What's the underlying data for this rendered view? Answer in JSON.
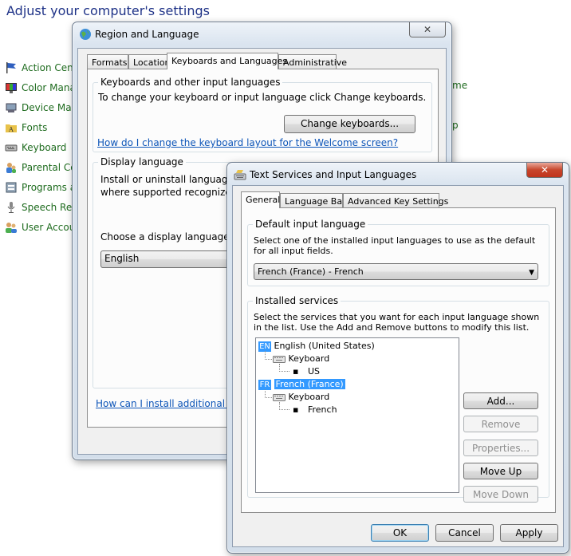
{
  "control_panel": {
    "title": "Adjust your computer's settings",
    "items": [
      {
        "label": "Action Center",
        "icon": "flag-icon"
      },
      {
        "label": "Color Management",
        "icon": "monitor-color-icon"
      },
      {
        "label": "Device Manager",
        "icon": "device-manager-icon"
      },
      {
        "label": "Fonts",
        "icon": "fonts-folder-icon"
      },
      {
        "label": "Keyboard",
        "icon": "keyboard-icon"
      },
      {
        "label": "Parental Controls",
        "icon": "parental-controls-icon"
      },
      {
        "label": "Programs and Features",
        "icon": "programs-icon"
      },
      {
        "label": "Speech Recognition",
        "icon": "microphone-icon"
      },
      {
        "label": "User Accounts",
        "icon": "users-icon"
      }
    ],
    "right_fragments": [
      "me",
      "p"
    ]
  },
  "region_dialog": {
    "title": "Region and Language",
    "close_glyph": "✕",
    "tabs": [
      "Formats",
      "Location",
      "Keyboards and Languages",
      "Administrative"
    ],
    "active_tab": "Keyboards and Languages",
    "keyboards_group": {
      "title": "Keyboards and other input languages",
      "text": "To change your keyboard or input language click Change keyboards.",
      "button": "Change keyboards...",
      "link": "How do I change the keyboard layout for the Welcome screen?"
    },
    "display_group": {
      "title": "Display language",
      "text_line1": "Install or uninstall languages",
      "text_line2": "where supported recognize s",
      "choose_label": "Choose a display language:",
      "selected": "English"
    },
    "bottom_link": "How can I install additional lang"
  },
  "text_services_dialog": {
    "title": "Text Services and Input Languages",
    "close_glyph": "✕",
    "tabs": [
      "General",
      "Language Bar",
      "Advanced Key Settings"
    ],
    "active_tab": "General",
    "default_group": {
      "title": "Default input language",
      "text": "Select one of the installed input languages to use as the default for all input fields.",
      "selected": "French (France) - French"
    },
    "installed_group": {
      "title": "Installed services",
      "text": "Select the services that you want for each input language shown in the list. Use the Add and Remove buttons to modify this list.",
      "tree": [
        {
          "badge": "EN",
          "language": "English (United States)",
          "category": "Keyboard",
          "service": "US",
          "selected": false
        },
        {
          "badge": "FR",
          "language": "French (France)",
          "category": "Keyboard",
          "service": "French",
          "selected": true
        }
      ],
      "buttons": {
        "add": "Add...",
        "remove": "Remove",
        "properties": "Properties...",
        "move_up": "Move Up",
        "move_down": "Move Down"
      }
    },
    "footer": {
      "ok": "OK",
      "cancel": "Cancel",
      "apply": "Apply"
    }
  }
}
